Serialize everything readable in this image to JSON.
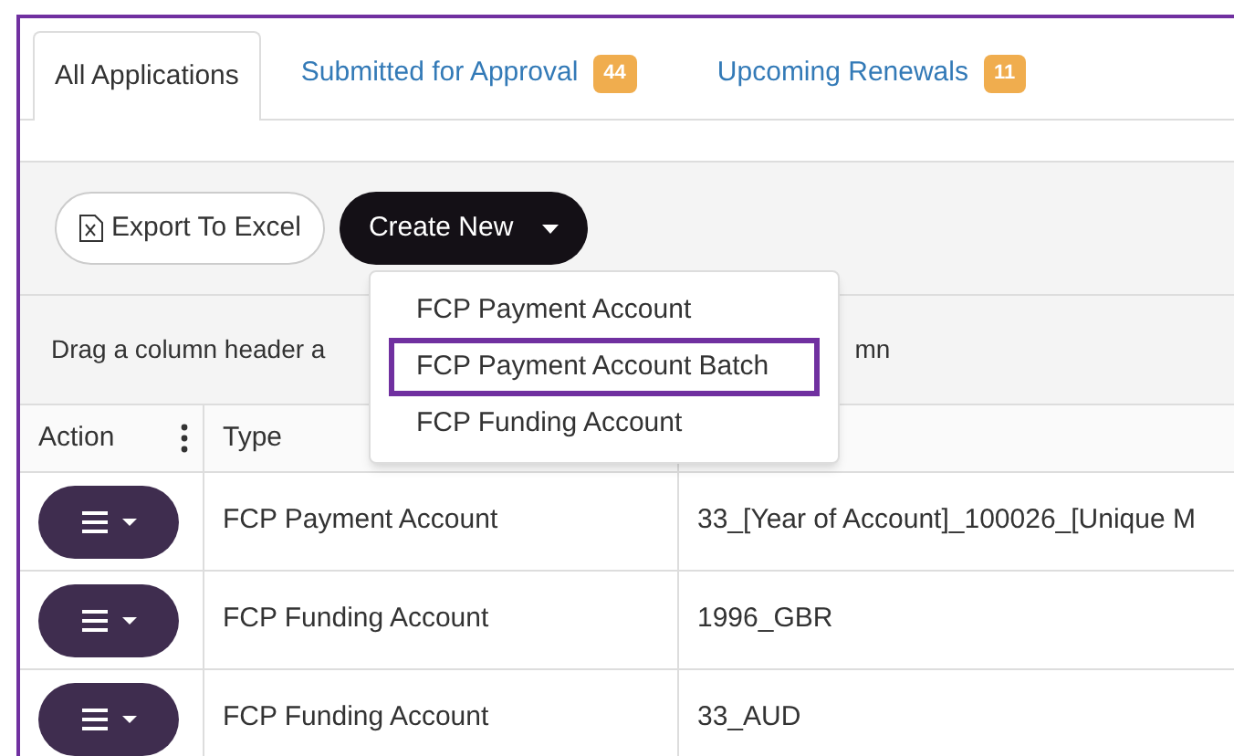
{
  "tabs": [
    {
      "label": "All Applications",
      "selected": true
    },
    {
      "label": "Submitted for Approval",
      "badge": "44",
      "selected": false
    },
    {
      "label": "Upcoming Renewals",
      "badge": "11",
      "selected": false
    }
  ],
  "toolbar": {
    "export_button": "Export To Excel",
    "create_button": "Create New"
  },
  "create_menu": {
    "items": [
      {
        "label": "FCP Payment Account",
        "selected": false
      },
      {
        "label": "FCP Payment Account Batch",
        "selected": true
      },
      {
        "label": "FCP Funding Account",
        "selected": false
      }
    ]
  },
  "group_panel": {
    "hint_start": "Drag a column header a",
    "hint_end": "mn"
  },
  "table": {
    "columns": [
      "Action",
      "Type"
    ],
    "rows": [
      {
        "type": "FCP Payment Account",
        "column_3": "33_[Year of Account]_100026_[Unique M"
      },
      {
        "type": "FCP Funding Account",
        "column_3": "1996_GBR"
      },
      {
        "type": "FCP Funding Account",
        "column_3": "33_AUD"
      }
    ]
  }
}
